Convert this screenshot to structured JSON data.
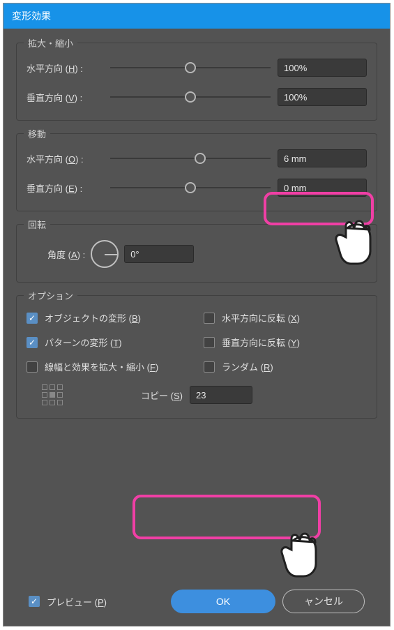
{
  "title": "変形効果",
  "groups": {
    "scale": {
      "title": "拡大・縮小",
      "h_prefix": "水平方向 (",
      "h_u": "H",
      "h_suffix": ") :",
      "h_value": "100%",
      "v_prefix": "垂直方向 (",
      "v_u": "V",
      "v_suffix": ") :",
      "v_value": "100%"
    },
    "move": {
      "title": "移動",
      "h_prefix": "水平方向 (",
      "h_u": "O",
      "h_suffix": ") :",
      "h_value": "6 mm",
      "v_prefix": "垂直方向 (",
      "v_u": "E",
      "v_suffix": ") :",
      "v_value": "0 mm"
    },
    "rotate": {
      "title": "回転",
      "label_prefix": "角度 (",
      "label_u": "A",
      "label_suffix": ") :",
      "value": "0°"
    },
    "options": {
      "title": "オプション",
      "transform_objects_prefix": "オブジェクトの変形 (",
      "transform_objects_u": "B",
      "transform_objects_suffix": ")",
      "reflect_x_prefix": "水平方向に反転 (",
      "reflect_x_u": "X",
      "reflect_x_suffix": ")",
      "transform_patterns_prefix": "パターンの変形 (",
      "transform_patterns_u": "T",
      "transform_patterns_suffix": ")",
      "reflect_y_prefix": "垂直方向に反転 (",
      "reflect_y_u": "Y",
      "reflect_y_suffix": ")",
      "scale_strokes_prefix": "線幅と効果を拡大・縮小 (",
      "scale_strokes_u": "F",
      "scale_strokes_suffix": ")",
      "random_prefix": "ランダム (",
      "random_u": "R",
      "random_suffix": ")",
      "copies_prefix": "コピー (",
      "copies_u": "S",
      "copies_suffix": ")",
      "copies_value": "23"
    }
  },
  "footer": {
    "preview_prefix": "プレビュー (",
    "preview_u": "P",
    "preview_suffix": ")",
    "ok": "OK",
    "cancel": "ャンセル"
  }
}
